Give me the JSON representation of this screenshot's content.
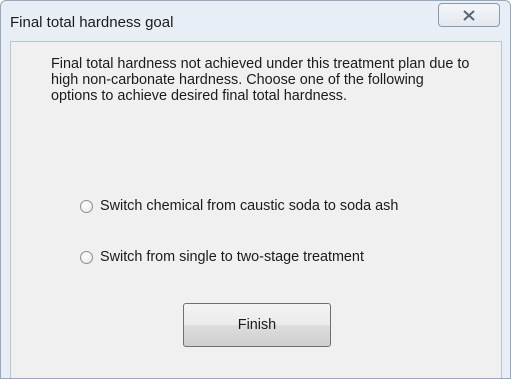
{
  "window": {
    "title": "Final total hardness goal",
    "close_icon": "close-icon"
  },
  "dialog": {
    "message": "Final total hardness not achieved under this treatment plan due to high non-carbonate hardness.  Choose one of the following options to achieve desired final total hardness.",
    "options": [
      {
        "label": "Switch chemical from caustic soda to soda ash",
        "selected": false
      },
      {
        "label": "Switch from single to two-stage treatment",
        "selected": false
      }
    ],
    "finish_label": "Finish"
  },
  "colors": {
    "frame": "#e8eef6",
    "client": "#f0f0f0",
    "text": "#1b1b1b"
  }
}
